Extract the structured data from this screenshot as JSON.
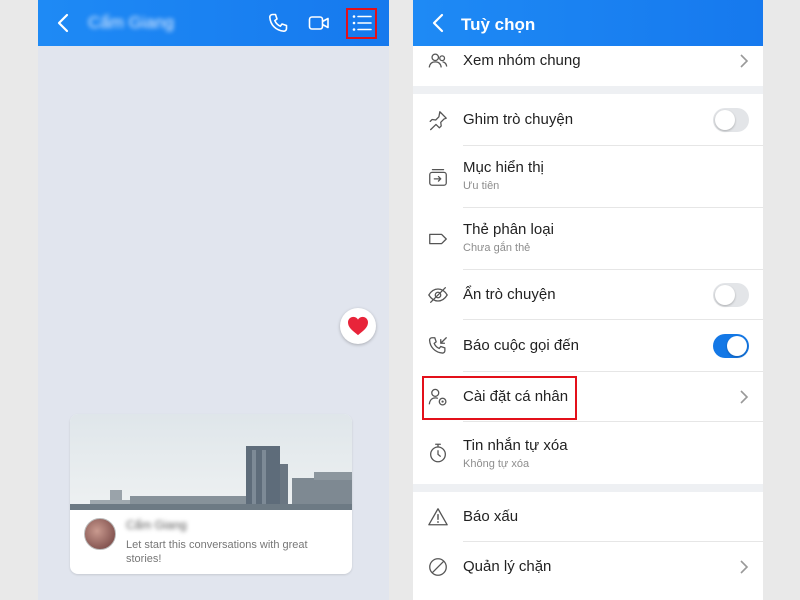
{
  "left": {
    "contact_name": "Cẩm Giang",
    "card": {
      "name": "Cẩm Giang",
      "message": "Let start this conversations with great stories!"
    }
  },
  "right": {
    "title": "Tuỳ chọn",
    "items": [
      {
        "label": "Xem nhóm chung",
        "icon": "group-icon",
        "control": "chevron"
      },
      {
        "label": "Ghim trò chuyện",
        "icon": "pin-icon",
        "control": "toggle",
        "on": false
      },
      {
        "label": "Mục hiển thị",
        "sub": "Ưu tiên",
        "icon": "inbox-icon",
        "control": "none"
      },
      {
        "label": "Thẻ phân loại",
        "sub": "Chưa gắn thẻ",
        "icon": "tag-icon",
        "control": "none"
      },
      {
        "label": "Ẩn trò chuyện",
        "icon": "eye-off-icon",
        "control": "toggle",
        "on": false
      },
      {
        "label": "Báo cuộc gọi đến",
        "icon": "incoming-call-icon",
        "control": "toggle",
        "on": true
      },
      {
        "label": "Cài đặt cá nhân",
        "icon": "user-settings-icon",
        "control": "chevron"
      },
      {
        "label": "Tin nhắn tự xóa",
        "sub": "Không tự xóa",
        "icon": "timer-icon",
        "control": "none"
      },
      {
        "label": "Báo xấu",
        "icon": "warning-icon",
        "control": "none"
      },
      {
        "label": "Quản lý chặn",
        "icon": "block-icon",
        "control": "chevron"
      }
    ]
  },
  "colors": {
    "header": "#1e8af5",
    "highlight": "#e3101a",
    "toggle_on": "#1478e6"
  }
}
